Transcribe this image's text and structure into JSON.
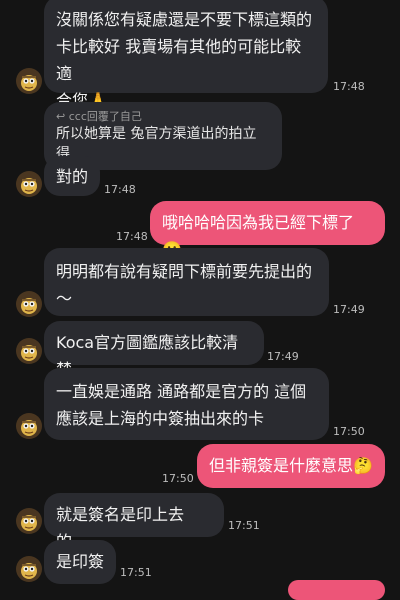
{
  "messages": [
    {
      "id": "m1",
      "text": "沒關係您有疑慮還是不要下標這類的\n卡比較好 我賣場有其他的可能比較適\n合您🙏",
      "time": "17:48"
    },
    {
      "id": "m2",
      "reply_header": "ccc回覆了自己",
      "reply_quote": "所以她算是 兔官方渠道出的拍立得",
      "text": "對的",
      "time": "17:48"
    },
    {
      "id": "m3",
      "text": "哦哈哈哈因為我已經下標了🥲",
      "time": "17:48"
    },
    {
      "id": "m4",
      "text": "明明都有說有疑問下標前要先提出的\n～",
      "time": "17:49"
    },
    {
      "id": "m5",
      "text": "Koca官方圖鑑應該比較清楚",
      "time": "17:49"
    },
    {
      "id": "m6",
      "text": "一直娛是通路 通路都是官方的 這個\n應該是上海的中簽抽出來的卡",
      "time": "17:50"
    },
    {
      "id": "m7",
      "text": "但非親簽是什麼意思🤔",
      "time": "17:50"
    },
    {
      "id": "m8",
      "text": "就是簽名是印上去的…",
      "time": "17:51"
    },
    {
      "id": "m9",
      "text": "是印簽",
      "time": "17:51"
    }
  ],
  "icons": {
    "avatar": "seller-avatar-icon",
    "reply": "reply-arrow-icon"
  },
  "colors": {
    "background": "#141414",
    "incoming_bubble": "#2a2b30",
    "outgoing_bubble": "#ed5578"
  }
}
